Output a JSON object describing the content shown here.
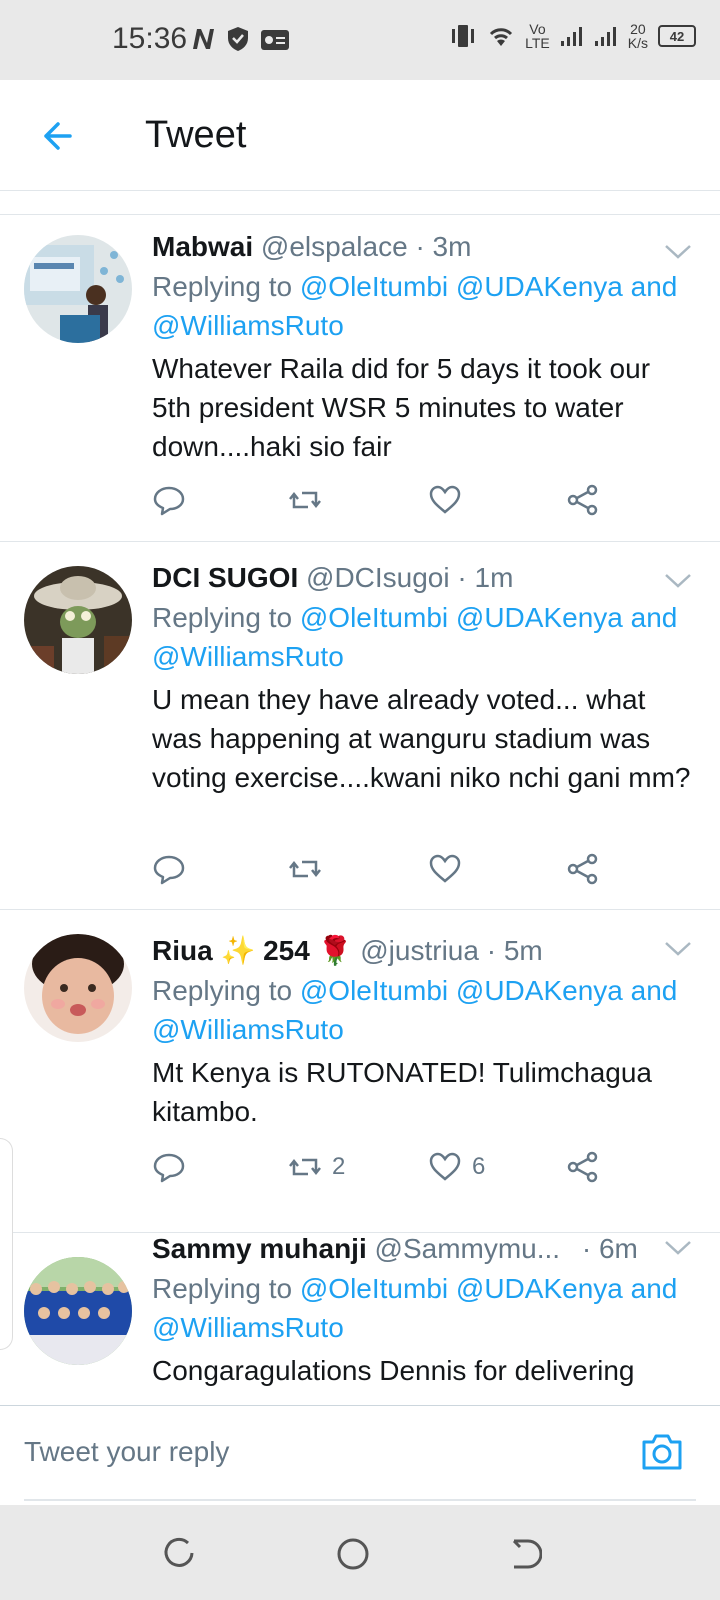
{
  "status_bar": {
    "time": "15:36",
    "net_speed_value": "20",
    "net_speed_unit": "K/s",
    "net_type_top": "Vo",
    "net_type_bottom": "LTE",
    "battery": "42"
  },
  "header": {
    "title": "Tweet"
  },
  "tweets": [
    {
      "name": "Mabwai",
      "handle": "@elspalace",
      "time": "· 3m",
      "replying_prefix": "Replying to",
      "mentions": [
        "@OleItumbi",
        "@UDAKenya",
        "and",
        "@WilliamsRuto"
      ],
      "text": "Whatever Raila did for 5 days it took our 5th president WSR 5 minutes to water down....haki sio fair",
      "retweets": "",
      "likes": ""
    },
    {
      "name": "DCI SUGOI",
      "handle": "@DCIsugoi",
      "time": "· 1m",
      "replying_prefix": "Replying to",
      "mentions": [
        "@OleItumbi",
        "@UDAKenya",
        "and",
        "@WilliamsRuto"
      ],
      "text": "U mean they have already voted... what was happening at wanguru stadium was voting exercise....kwani niko nchi gani mm?",
      "retweets": "",
      "likes": ""
    },
    {
      "name": "Riua ✨ 254 🌹",
      "handle": "@justriua",
      "time": "· 5m",
      "replying_prefix": "Replying to",
      "mentions": [
        "@OleItumbi",
        "@UDAKenya",
        "and",
        "@WilliamsRuto"
      ],
      "text": "Mt Kenya is RUTONATED! Tulimchagua kitambo.",
      "retweets": "2",
      "likes": "6"
    },
    {
      "name": "Sammy muhanji",
      "handle": "@Sammymu...",
      "time": "· 6m",
      "replying_prefix": "Replying to",
      "mentions": [
        "@OleItumbi",
        "@UDAKenya",
        "and",
        "@WilliamsRuto"
      ],
      "text": "Congaragulations Dennis for delivering"
    }
  ],
  "reply_bar": {
    "placeholder": "Tweet your reply"
  },
  "colors": {
    "accent": "#1da1f2",
    "secondary_text": "#657786",
    "divider": "#e1e6ea"
  }
}
